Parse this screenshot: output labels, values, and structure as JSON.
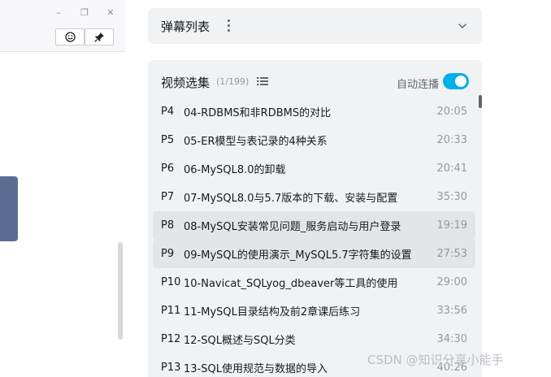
{
  "danmaku": {
    "title": "弹幕列表"
  },
  "collection": {
    "title": "视频选集",
    "count": "(1/199)",
    "autoplay_label": "自动连播",
    "autoplay_on": true,
    "episodes": [
      {
        "no": "P4",
        "title": "04-RDBMS和非RDBMS的对比",
        "duration": "20:05"
      },
      {
        "no": "P5",
        "title": "05-ER模型与表记录的4种关系",
        "duration": "20:33"
      },
      {
        "no": "P6",
        "title": "06-MySQL8.0的卸载",
        "duration": "20:41"
      },
      {
        "no": "P7",
        "title": "07-MySQL8.0与5.7版本的下载、安装与配置",
        "duration": "35:30"
      },
      {
        "no": "P8",
        "title": "08-MySQL安装常见问题_服务启动与用户登录",
        "duration": "19:19"
      },
      {
        "no": "P9",
        "title": "09-MySQL的使用演示_MySQL5.7字符集的设置",
        "duration": "27:53"
      },
      {
        "no": "P10",
        "title": "10-Navicat_SQLyog_dbeaver等工具的使用",
        "duration": "29:00"
      },
      {
        "no": "P11",
        "title": "11-MySQL目录结构及前2章课后练习",
        "duration": "33:56"
      },
      {
        "no": "P12",
        "title": "12-SQL概述与SQL分类",
        "duration": "34:30"
      },
      {
        "no": "P13",
        "title": "13-SQL使用规范与数据的导入",
        "duration": "40:26"
      }
    ]
  },
  "window": {
    "controls": [
      "minimize-icon",
      "restore-icon",
      "close-icon"
    ],
    "tools": [
      "emoji-icon",
      "pin-icon"
    ]
  },
  "watermark": "CSDN @知识分享小能手",
  "colors": {
    "accent": "#00aeec",
    "panel_bg": "#f1f2f3",
    "highlight_row": "#e3e5e7",
    "side_tab": "#5c6d94"
  }
}
